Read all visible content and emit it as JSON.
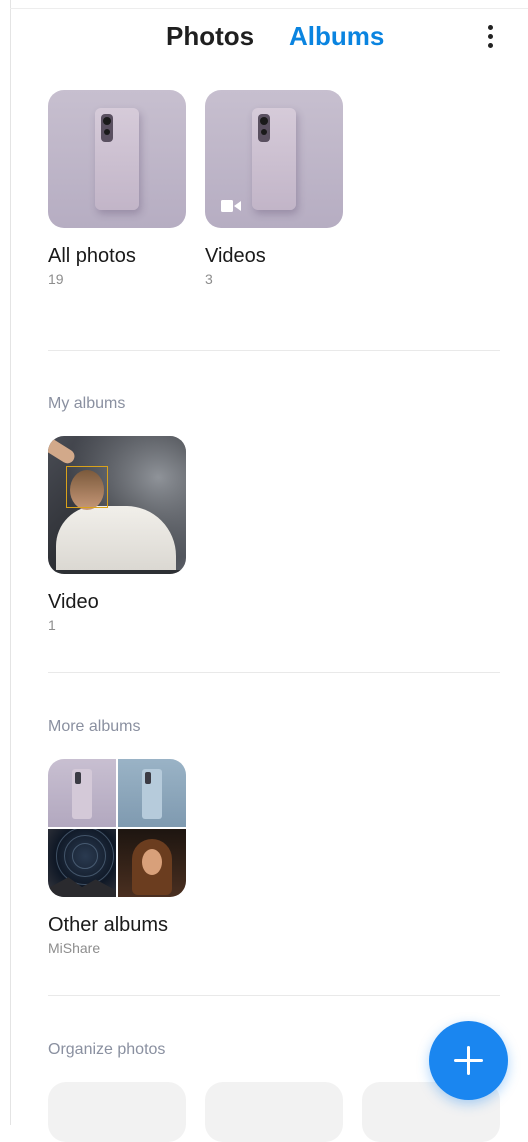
{
  "header": {
    "tabs": [
      {
        "label": "Photos",
        "active": false
      },
      {
        "label": "Albums",
        "active": true
      }
    ],
    "more_icon": "more-vertical-icon",
    "active_color": "#0a84e0"
  },
  "default_albums": [
    {
      "title": "All photos",
      "subtitle": "19"
    },
    {
      "title": "Videos",
      "subtitle": "3",
      "badge_icon": "video-camera-icon"
    }
  ],
  "my_albums": {
    "heading": "My albums",
    "items": [
      {
        "title": "Video",
        "subtitle": "1"
      }
    ]
  },
  "more_albums": {
    "heading": "More albums",
    "items": [
      {
        "title": "Other albums",
        "subtitle": "MiShare"
      }
    ]
  },
  "organize": {
    "heading": "Organize photos"
  },
  "fab": {
    "icon": "plus-icon",
    "color": "#1a86f0"
  }
}
